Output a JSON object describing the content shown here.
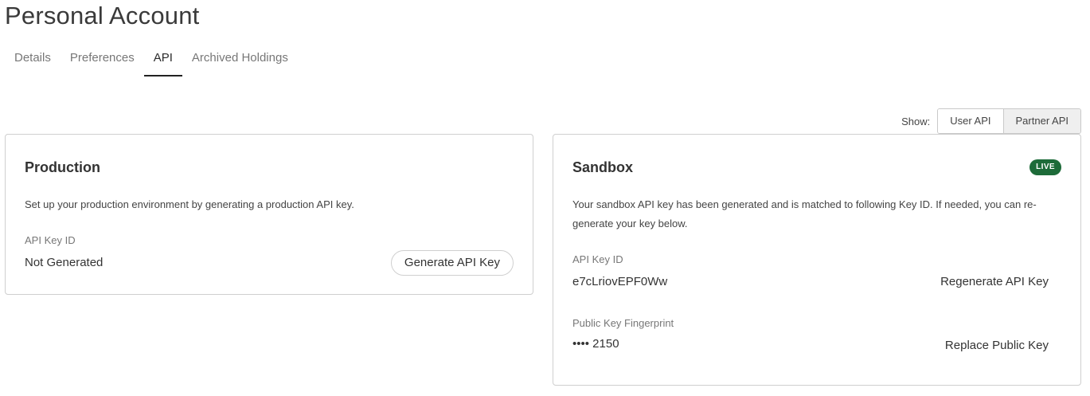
{
  "page": {
    "title": "Personal Account"
  },
  "tabs": [
    {
      "label": "Details",
      "active": false
    },
    {
      "label": "Preferences",
      "active": false
    },
    {
      "label": "API",
      "active": true
    },
    {
      "label": "Archived Holdings",
      "active": false
    }
  ],
  "show_toggle": {
    "label": "Show:",
    "options": [
      "User API",
      "Partner API"
    ],
    "selected": "Partner API"
  },
  "production": {
    "title": "Production",
    "description": "Set up your production environment by generating a production API key.",
    "api_key_label": "API Key ID",
    "api_key_value": "Not Generated",
    "generate_button": "Generate API Key"
  },
  "sandbox": {
    "title": "Sandbox",
    "badge": "LIVE",
    "description": "Your sandbox API key has been generated and is matched to following Key ID. If needed, you can re-generate your key below.",
    "api_key_label": "API Key ID",
    "api_key_value": "e7cLriovEPF0Ww",
    "regenerate_button": "Regenerate API Key",
    "fingerprint_label": "Public Key Fingerprint",
    "fingerprint_value": "•••• 2150",
    "replace_button": "Replace Public Key"
  },
  "colors": {
    "live_badge": "#1d6b39",
    "active_tab_underline": "#222222",
    "border": "#cfcfcf"
  }
}
